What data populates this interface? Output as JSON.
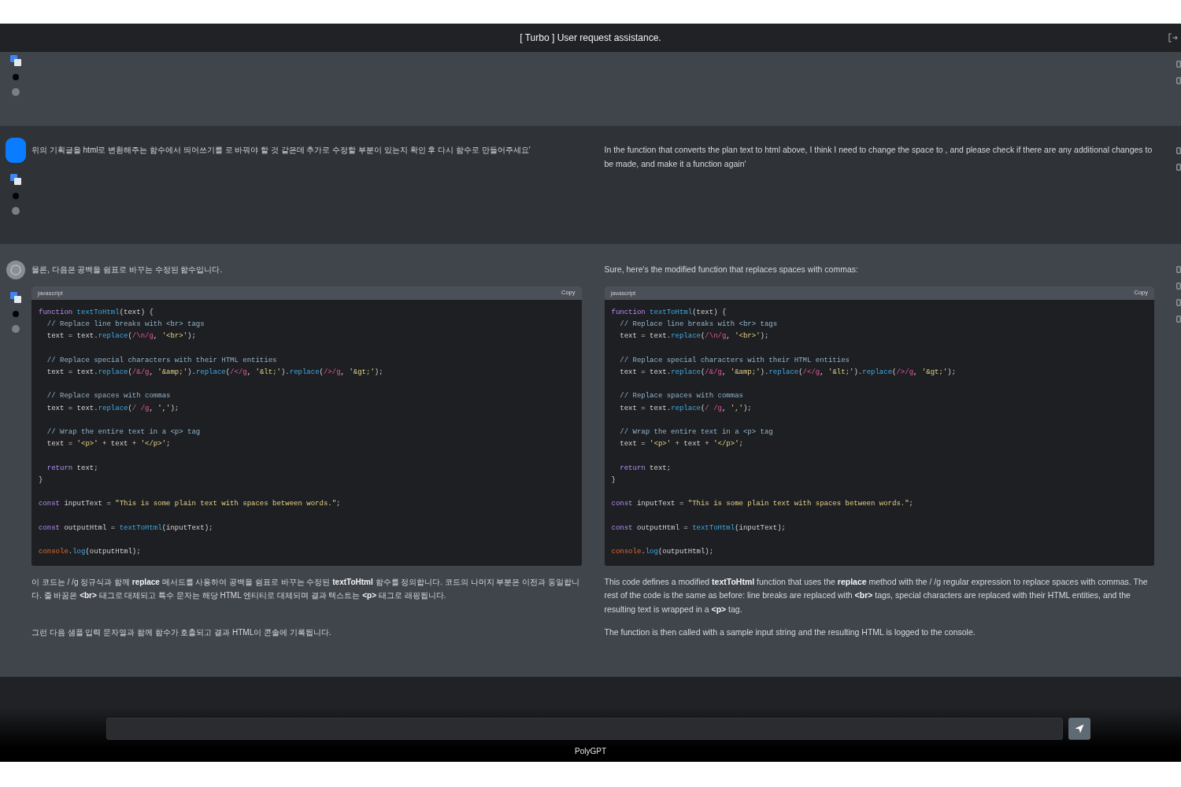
{
  "window": {
    "title": "[ Turbo ] User request assistance."
  },
  "messages": [
    {
      "kind": "system"
    },
    {
      "kind": "user",
      "columns": [
        {
          "blocks": [
            {
              "kind": "paragraph",
              "text": "위의 기획글을 html로 변환해주는 함수에서 띄어쓰기를 로 바꿔야 할 것 같은데 추가로 수정할 부분이 있는지 확인 후 다시 함수로 만들어주세요'"
            }
          ]
        },
        {
          "blocks": [
            {
              "kind": "paragraph",
              "text": "In the function that converts the plan text to html above, I think I need to change the space to , and please check if there are any additional changes to be made, and make it a function again'"
            }
          ]
        }
      ]
    },
    {
      "kind": "assistant",
      "columns": [
        {
          "blocks": [
            {
              "kind": "paragraph",
              "text": "물론, 다음은 공백을 쉼표로 바꾸는 수정된 함수입니다."
            },
            {
              "kind": "code",
              "language": "javascript",
              "copy": "Copy",
              "groups": [
                [
                  [
                    {
                      "kind": "keyword",
                      "text": "function"
                    },
                    {
                      "kind": "function",
                      "text": " textToHtml"
                    },
                    {
                      "kind": "plain",
                      "text": "(text) {"
                    }
                  ],
                  [
                    {
                      "kind": "comment",
                      "text": "  // Replace line breaks with <br> tags"
                    }
                  ],
                  [
                    {
                      "kind": "plain",
                      "text": "  text = text."
                    },
                    {
                      "kind": "function",
                      "text": "replace"
                    },
                    {
                      "kind": "plain",
                      "text": "("
                    },
                    {
                      "kind": "regex",
                      "text": "/\\n/g"
                    },
                    {
                      "kind": "plain",
                      "text": ", "
                    },
                    {
                      "kind": "string",
                      "text": "'<br>'"
                    },
                    {
                      "kind": "plain",
                      "text": ");"
                    }
                  ]
                ],
                [
                  [
                    {
                      "kind": "comment",
                      "text": "  // Replace special characters with their HTML entities"
                    }
                  ],
                  [
                    {
                      "kind": "plain",
                      "text": "  text = text."
                    },
                    {
                      "kind": "function",
                      "text": "replace"
                    },
                    {
                      "kind": "plain",
                      "text": "("
                    },
                    {
                      "kind": "regex",
                      "text": "/&/g"
                    },
                    {
                      "kind": "plain",
                      "text": ", "
                    },
                    {
                      "kind": "string",
                      "text": "'&amp;'"
                    },
                    {
                      "kind": "plain",
                      "text": ")."
                    },
                    {
                      "kind": "function",
                      "text": "replace"
                    },
                    {
                      "kind": "plain",
                      "text": "("
                    },
                    {
                      "kind": "regex",
                      "text": "/</g"
                    },
                    {
                      "kind": "plain",
                      "text": ", "
                    },
                    {
                      "kind": "string",
                      "text": "'&lt;'"
                    },
                    {
                      "kind": "plain",
                      "text": ")."
                    },
                    {
                      "kind": "function",
                      "text": "replace"
                    },
                    {
                      "kind": "plain",
                      "text": "("
                    },
                    {
                      "kind": "regex",
                      "text": "/>/g"
                    },
                    {
                      "kind": "plain",
                      "text": ", "
                    },
                    {
                      "kind": "string",
                      "text": "'&gt;'"
                    },
                    {
                      "kind": "plain",
                      "text": ");"
                    }
                  ]
                ],
                [
                  [
                    {
                      "kind": "comment",
                      "text": "  // Replace spaces with commas"
                    }
                  ],
                  [
                    {
                      "kind": "plain",
                      "text": "  text = text."
                    },
                    {
                      "kind": "function",
                      "text": "replace"
                    },
                    {
                      "kind": "plain",
                      "text": "("
                    },
                    {
                      "kind": "regex",
                      "text": "/ /g"
                    },
                    {
                      "kind": "plain",
                      "text": ", "
                    },
                    {
                      "kind": "string",
                      "text": "','"
                    },
                    {
                      "kind": "plain",
                      "text": ");"
                    }
                  ]
                ],
                [
                  [
                    {
                      "kind": "comment",
                      "text": "  // Wrap the entire text in a <p> tag"
                    }
                  ],
                  [
                    {
                      "kind": "plain",
                      "text": "  text = "
                    },
                    {
                      "kind": "string",
                      "text": "'<p>'"
                    },
                    {
                      "kind": "plain",
                      "text": " + text + "
                    },
                    {
                      "kind": "string",
                      "text": "'</p>'"
                    },
                    {
                      "kind": "plain",
                      "text": ";"
                    }
                  ]
                ],
                [
                  [
                    {
                      "kind": "keyword",
                      "text": "  return"
                    },
                    {
                      "kind": "plain",
                      "text": " text;"
                    }
                  ],
                  [
                    {
                      "kind": "plain",
                      "text": "}"
                    }
                  ]
                ],
                [
                  [
                    {
                      "kind": "keyword",
                      "text": "const"
                    },
                    {
                      "kind": "plain",
                      "text": " inputText = "
                    },
                    {
                      "kind": "string",
                      "text": "\"This is some plain text with spaces between words.\""
                    },
                    {
                      "kind": "plain",
                      "text": ";"
                    }
                  ]
                ],
                [
                  [
                    {
                      "kind": "keyword",
                      "text": "const"
                    },
                    {
                      "kind": "plain",
                      "text": " outputHtml = "
                    },
                    {
                      "kind": "function",
                      "text": "textToHtml"
                    },
                    {
                      "kind": "plain",
                      "text": "(inputText);"
                    }
                  ]
                ],
                [
                  [
                    {
                      "kind": "object",
                      "text": "console"
                    },
                    {
                      "kind": "plain",
                      "text": "."
                    },
                    {
                      "kind": "function",
                      "text": "log"
                    },
                    {
                      "kind": "plain",
                      "text": "(outputHtml);"
                    }
                  ]
                ]
              ]
            },
            {
              "kind": "paragraph",
              "text": "이 코드는 / /g 정규식과 함께 **replace** 메서드를 사용하여 공백을 쉼표로 바꾸는 수정된 **textToHtml** 함수를 정의합니다. 코드의 나머지 부분은 이전과 동일합니다. 줄 바꿈은 **<br>** 태그로 대체되고 특수 문자는 해당 HTML 엔티티로 대체되며 결과 텍스트는 **<p>** 태그로 래핑됩니다."
            },
            {
              "kind": "paragraph",
              "text": "그런 다음 샘플 입력 문자열과 함께 함수가 호출되고 결과 HTML이 콘솔에 기록됩니다."
            }
          ]
        },
        {
          "blocks": [
            {
              "kind": "paragraph",
              "text": "Sure, here's the modified function that replaces spaces with commas:"
            },
            {
              "kind": "code",
              "language": "javascript",
              "copy": "Copy",
              "groups": [
                [
                  [
                    {
                      "kind": "keyword",
                      "text": "function"
                    },
                    {
                      "kind": "function",
                      "text": " textToHtml"
                    },
                    {
                      "kind": "plain",
                      "text": "(text) {"
                    }
                  ],
                  [
                    {
                      "kind": "comment",
                      "text": "  // Replace line breaks with <br> tags"
                    }
                  ],
                  [
                    {
                      "kind": "plain",
                      "text": "  text = text."
                    },
                    {
                      "kind": "function",
                      "text": "replace"
                    },
                    {
                      "kind": "plain",
                      "text": "("
                    },
                    {
                      "kind": "regex",
                      "text": "/\\n/g"
                    },
                    {
                      "kind": "plain",
                      "text": ", "
                    },
                    {
                      "kind": "string",
                      "text": "'<br>'"
                    },
                    {
                      "kind": "plain",
                      "text": ");"
                    }
                  ]
                ],
                [
                  [
                    {
                      "kind": "comment",
                      "text": "  // Replace special characters with their HTML entities"
                    }
                  ],
                  [
                    {
                      "kind": "plain",
                      "text": "  text = text."
                    },
                    {
                      "kind": "function",
                      "text": "replace"
                    },
                    {
                      "kind": "plain",
                      "text": "("
                    },
                    {
                      "kind": "regex",
                      "text": "/&/g"
                    },
                    {
                      "kind": "plain",
                      "text": ", "
                    },
                    {
                      "kind": "string",
                      "text": "'&amp;'"
                    },
                    {
                      "kind": "plain",
                      "text": ")."
                    },
                    {
                      "kind": "function",
                      "text": "replace"
                    },
                    {
                      "kind": "plain",
                      "text": "("
                    },
                    {
                      "kind": "regex",
                      "text": "/</g"
                    },
                    {
                      "kind": "plain",
                      "text": ", "
                    },
                    {
                      "kind": "string",
                      "text": "'&lt;'"
                    },
                    {
                      "kind": "plain",
                      "text": ")."
                    },
                    {
                      "kind": "function",
                      "text": "replace"
                    },
                    {
                      "kind": "plain",
                      "text": "("
                    },
                    {
                      "kind": "regex",
                      "text": "/>/g"
                    },
                    {
                      "kind": "plain",
                      "text": ", "
                    },
                    {
                      "kind": "string",
                      "text": "'&gt;'"
                    },
                    {
                      "kind": "plain",
                      "text": ");"
                    }
                  ]
                ],
                [
                  [
                    {
                      "kind": "comment",
                      "text": "  // Replace spaces with commas"
                    }
                  ],
                  [
                    {
                      "kind": "plain",
                      "text": "  text = text."
                    },
                    {
                      "kind": "function",
                      "text": "replace"
                    },
                    {
                      "kind": "plain",
                      "text": "("
                    },
                    {
                      "kind": "regex",
                      "text": "/ /g"
                    },
                    {
                      "kind": "plain",
                      "text": ", "
                    },
                    {
                      "kind": "string",
                      "text": "','"
                    },
                    {
                      "kind": "plain",
                      "text": ");"
                    }
                  ]
                ],
                [
                  [
                    {
                      "kind": "comment",
                      "text": "  // Wrap the entire text in a <p> tag"
                    }
                  ],
                  [
                    {
                      "kind": "plain",
                      "text": "  text = "
                    },
                    {
                      "kind": "string",
                      "text": "'<p>'"
                    },
                    {
                      "kind": "plain",
                      "text": " + text + "
                    },
                    {
                      "kind": "string",
                      "text": "'</p>'"
                    },
                    {
                      "kind": "plain",
                      "text": ";"
                    }
                  ]
                ],
                [
                  [
                    {
                      "kind": "keyword",
                      "text": "  return"
                    },
                    {
                      "kind": "plain",
                      "text": " text;"
                    }
                  ],
                  [
                    {
                      "kind": "plain",
                      "text": "}"
                    }
                  ]
                ],
                [
                  [
                    {
                      "kind": "keyword",
                      "text": "const"
                    },
                    {
                      "kind": "plain",
                      "text": " inputText = "
                    },
                    {
                      "kind": "string",
                      "text": "\"This is some plain text with spaces between words.\""
                    },
                    {
                      "kind": "plain",
                      "text": ";"
                    }
                  ]
                ],
                [
                  [
                    {
                      "kind": "keyword",
                      "text": "const"
                    },
                    {
                      "kind": "plain",
                      "text": " outputHtml = "
                    },
                    {
                      "kind": "function",
                      "text": "textToHtml"
                    },
                    {
                      "kind": "plain",
                      "text": "(inputText);"
                    }
                  ]
                ],
                [
                  [
                    {
                      "kind": "object",
                      "text": "console"
                    },
                    {
                      "kind": "plain",
                      "text": "."
                    },
                    {
                      "kind": "function",
                      "text": "log"
                    },
                    {
                      "kind": "plain",
                      "text": "(outputHtml);"
                    }
                  ]
                ]
              ]
            },
            {
              "kind": "paragraph",
              "text": "This code defines a modified **textToHtml** function that uses the **replace** method with the / /g regular expression to replace spaces with commas. The rest of the code is the same as before: line breaks are replaced with **<br>** tags, special characters are replaced with their HTML entities, and the resulting text is wrapped in a **<p>** tag."
            },
            {
              "kind": "paragraph",
              "text": "The function is then called with a sample input string and the resulting HTML is logged to the console."
            }
          ]
        }
      ]
    }
  ],
  "footer": {
    "label": "PolyGPT"
  }
}
